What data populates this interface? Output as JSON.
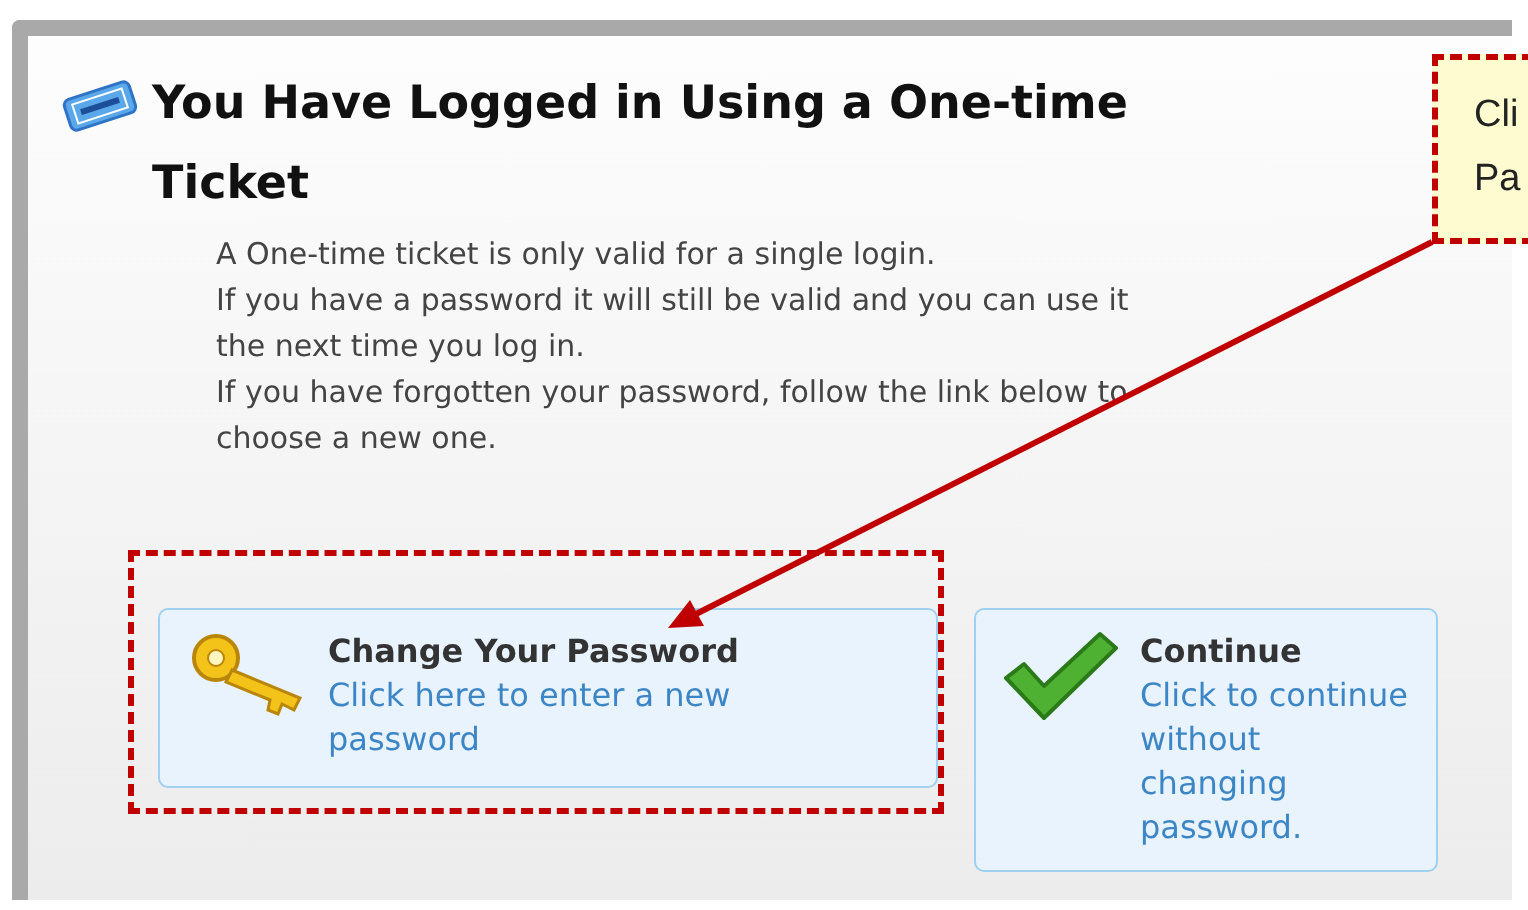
{
  "dialog": {
    "title": "You Have Logged in Using a One-time Ticket",
    "paragraphs": [
      "A One-time ticket is only valid for a single login.",
      "If you have a password it will still be valid and you can use it the next time you log in.",
      "If you have forgotten your password, follow the link below to choose a new one."
    ],
    "options": [
      {
        "kind": "key",
        "title": "Change Your Password",
        "description": "Click here to enter a new password",
        "highlighted": true
      },
      {
        "kind": "check",
        "title": "Continue",
        "description": "Click to continue without changing password.",
        "highlighted": false
      }
    ]
  },
  "callout": {
    "lines": [
      "Cli",
      "Pa"
    ]
  }
}
